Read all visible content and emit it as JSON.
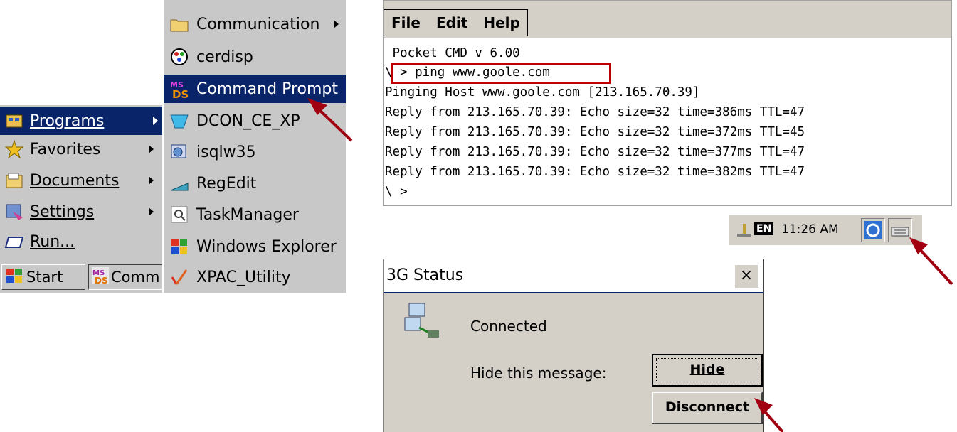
{
  "start_menu": {
    "items": [
      {
        "label": "Programs",
        "icon": "programs-icon"
      },
      {
        "label": "Favorites",
        "icon": "favorites-star-icon"
      },
      {
        "label": "Documents",
        "icon": "documents-icon"
      },
      {
        "label": "Settings",
        "icon": "settings-icon"
      },
      {
        "label": "Run...",
        "icon": "run-icon"
      }
    ]
  },
  "taskbar": {
    "start_label": "Start",
    "task_label": "Comm"
  },
  "programs_menu": {
    "items": [
      {
        "label": "Communication",
        "icon": "folder-icon"
      },
      {
        "label": "cerdisp",
        "icon": "cerdisp-icon"
      },
      {
        "label": "Command Prompt",
        "icon": "command-prompt-icon"
      },
      {
        "label": "DCON_CE_XP",
        "icon": "dcon-icon"
      },
      {
        "label": "isqlw35",
        "icon": "isqlw-icon"
      },
      {
        "label": "RegEdit",
        "icon": "regedit-icon"
      },
      {
        "label": "TaskManager",
        "icon": "taskmanager-icon"
      },
      {
        "label": "Windows Explorer",
        "icon": "windows-flag-icon"
      },
      {
        "label": "XPAC_Utility",
        "icon": "xpac-icon"
      }
    ]
  },
  "cmd_window": {
    "menu": {
      "file": "File",
      "edit": "Edit",
      "help": "Help"
    },
    "lines": [
      " Pocket CMD v 6.00",
      "\\ > ping www.goole.com",
      "Pinging Host www.goole.com [213.165.70.39]",
      "Reply from 213.165.70.39: Echo size=32 time=386ms TTL=47",
      "Reply from 213.165.70.39: Echo size=32 time=372ms TTL=45",
      "Reply from 213.165.70.39: Echo size=32 time=377ms TTL=47",
      "Reply from 213.165.70.39: Echo size=32 time=382ms TTL=47",
      "\\ >"
    ]
  },
  "tray": {
    "lang": "EN",
    "time": "11:26 AM"
  },
  "dialog": {
    "title": "3G Status",
    "close": "×",
    "status": "Connected",
    "hide_prompt": "Hide this message:",
    "hide_button": "Hide",
    "disconnect_button": "Disconnect"
  },
  "colors": {
    "menu_gray": "#c8c8c8",
    "highlight": "#0a246a",
    "annotation_red": "#c00000",
    "arrow": "#a00010"
  }
}
